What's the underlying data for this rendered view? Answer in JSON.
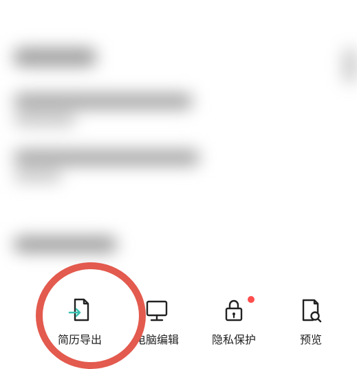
{
  "toolbar": {
    "items": [
      {
        "id": "export",
        "label": "简历导出",
        "icon": "export-file-icon",
        "highlighted": true,
        "badge": false
      },
      {
        "id": "pcedit",
        "label": "电脑编辑",
        "icon": "monitor-icon",
        "highlighted": false,
        "badge": false
      },
      {
        "id": "privacy",
        "label": "隐私保护",
        "icon": "lock-icon",
        "highlighted": false,
        "badge": true
      },
      {
        "id": "preview",
        "label": "预览",
        "icon": "file-search-icon",
        "highlighted": false,
        "badge": false
      }
    ]
  },
  "colors": {
    "highlight_ring": "#e35a4e",
    "badge": "#ff4d4d",
    "stroke": "#222222",
    "accent": "#3ac1b2"
  }
}
